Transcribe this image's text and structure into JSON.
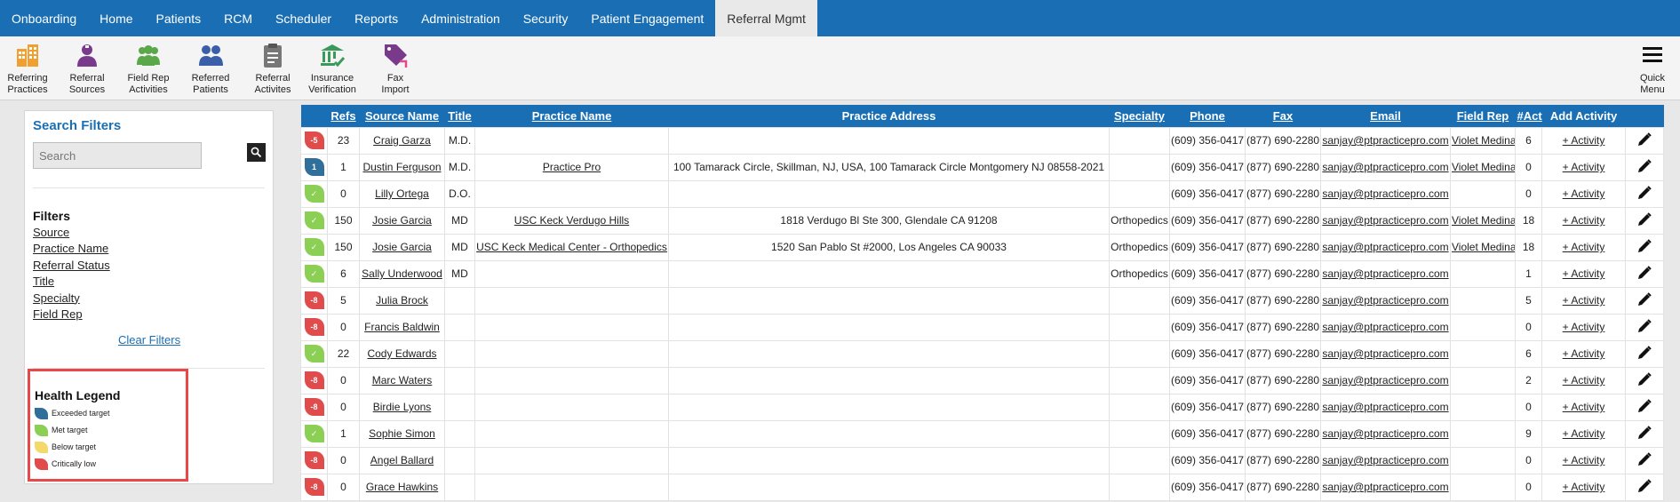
{
  "nav": {
    "items": [
      {
        "label": "Onboarding",
        "active": false
      },
      {
        "label": "Home",
        "active": false
      },
      {
        "label": "Patients",
        "active": false
      },
      {
        "label": "RCM",
        "active": false
      },
      {
        "label": "Scheduler",
        "active": false
      },
      {
        "label": "Reports",
        "active": false
      },
      {
        "label": "Administration",
        "active": false
      },
      {
        "label": "Security",
        "active": false
      },
      {
        "label": "Patient Engagement",
        "active": false
      },
      {
        "label": "Referral Mgmt",
        "active": true
      }
    ]
  },
  "toolbar": {
    "tools": [
      {
        "icon": "building-icon",
        "lines": [
          "Referring",
          "Practices"
        ],
        "color": "#f0a030"
      },
      {
        "icon": "doctor-icon",
        "lines": [
          "Referral",
          "Sources"
        ],
        "color": "#7a3a8c"
      },
      {
        "icon": "group-icon",
        "lines": [
          "Field Rep",
          "Activities"
        ],
        "color": "#5aa84a"
      },
      {
        "icon": "users-icon",
        "lines": [
          "Referred",
          "Patients"
        ],
        "color": "#3a5fa8"
      },
      {
        "icon": "clipboard-icon",
        "lines": [
          "Referral",
          "Activites"
        ],
        "color": "#777777"
      },
      {
        "icon": "bank-check-icon",
        "lines": [
          "Insurance",
          "Verification"
        ],
        "color": "#3a9a5a"
      },
      {
        "icon": "fax-tag-icon",
        "lines": [
          "Fax",
          "Import"
        ],
        "color": "#7a3a8c"
      }
    ],
    "quick_menu": [
      "Quick",
      "Menu"
    ]
  },
  "filters_panel": {
    "title": "Search Filters",
    "search_placeholder": "Search",
    "filters_heading": "Filters",
    "filters": [
      "Source",
      "Practice Name",
      "Referral Status",
      "Title",
      "Specialty",
      "Field Rep"
    ],
    "clear_label": "Clear Filters"
  },
  "legend": {
    "title": "Health Legend",
    "items": [
      {
        "label": "Exceeded target",
        "color": "#2f6f9a"
      },
      {
        "label": "Met target",
        "color": "#8ccf55"
      },
      {
        "label": "Below target",
        "color": "#f3d86a"
      },
      {
        "label": "Critically low",
        "color": "#e04b4b"
      }
    ]
  },
  "table": {
    "columns": [
      "",
      "Refs",
      "Source Name",
      "Title",
      "Practice Name",
      "Practice Address",
      "Specialty",
      "Phone",
      "Fax",
      "Email",
      "Field Rep",
      "#Act",
      "Add Activity",
      ""
    ],
    "add_activity_label": "+ Activity",
    "rows": [
      {
        "health": "red",
        "badge": "-5",
        "refs": "23",
        "source": "Craig Garza",
        "title": "M.D.",
        "practice": "",
        "address": "",
        "specialty": "",
        "phone": "(609) 356-0417",
        "fax": "(877) 690-2280",
        "email": "sanjay@ptpracticepro.com",
        "rep": "Violet Medina",
        "act": "6"
      },
      {
        "health": "blue",
        "badge": "1",
        "refs": "1",
        "source": "Dustin Ferguson",
        "title": "M.D.",
        "practice": "Practice Pro",
        "address": "100 Tamarack Circle, Skillman, NJ, USA, 100 Tamarack Circle Montgomery NJ 08558-2021",
        "specialty": "",
        "phone": "(609) 356-0417",
        "fax": "(877) 690-2280",
        "email": "sanjay@ptpracticepro.com",
        "rep": "Violet Medina",
        "act": "0"
      },
      {
        "health": "green",
        "badge": "✓",
        "refs": "0",
        "source": "Lilly Ortega",
        "title": "D.O.",
        "practice": "",
        "address": "",
        "specialty": "",
        "phone": "(609) 356-0417",
        "fax": "(877) 690-2280",
        "email": "sanjay@ptpracticepro.com",
        "rep": "",
        "act": "0"
      },
      {
        "health": "green",
        "badge": "✓",
        "refs": "150",
        "source": "Josie Garcia",
        "title": "MD",
        "practice": "USC Keck Verdugo Hills",
        "address": "1818 Verdugo Bl Ste 300, Glendale CA 91208",
        "specialty": "Orthopedics",
        "phone": "(609) 356-0417",
        "fax": "(877) 690-2280",
        "email": "sanjay@ptpracticepro.com",
        "rep": "Violet Medina",
        "act": "18"
      },
      {
        "health": "green",
        "badge": "✓",
        "refs": "150",
        "source": "Josie Garcia",
        "title": "MD",
        "practice": "USC Keck Medical Center - Orthopedics",
        "address": "1520 San Pablo St #2000, Los Angeles CA 90033",
        "specialty": "Orthopedics",
        "phone": "(609) 356-0417",
        "fax": "(877) 690-2280",
        "email": "sanjay@ptpracticepro.com",
        "rep": "Violet Medina",
        "act": "18"
      },
      {
        "health": "green",
        "badge": "✓",
        "refs": "6",
        "source": "Sally Underwood",
        "title": "MD",
        "practice": "",
        "address": "",
        "specialty": "Orthopedics",
        "phone": "(609) 356-0417",
        "fax": "(877) 690-2280",
        "email": "sanjay@ptpracticepro.com",
        "rep": "",
        "act": "1"
      },
      {
        "health": "red",
        "badge": "-8",
        "refs": "5",
        "source": "Julia Brock",
        "title": "",
        "practice": "",
        "address": "",
        "specialty": "",
        "phone": "(609) 356-0417",
        "fax": "(877) 690-2280",
        "email": "sanjay@ptpracticepro.com",
        "rep": "",
        "act": "5"
      },
      {
        "health": "red",
        "badge": "-8",
        "refs": "0",
        "source": "Francis Baldwin",
        "title": "",
        "practice": "",
        "address": "",
        "specialty": "",
        "phone": "(609) 356-0417",
        "fax": "(877) 690-2280",
        "email": "sanjay@ptpracticepro.com",
        "rep": "",
        "act": "0"
      },
      {
        "health": "green",
        "badge": "✓",
        "refs": "22",
        "source": "Cody Edwards",
        "title": "",
        "practice": "",
        "address": "",
        "specialty": "",
        "phone": "(609) 356-0417",
        "fax": "(877) 690-2280",
        "email": "sanjay@ptpracticepro.com",
        "rep": "",
        "act": "6"
      },
      {
        "health": "red",
        "badge": "-8",
        "refs": "0",
        "source": "Marc Waters",
        "title": "",
        "practice": "",
        "address": "",
        "specialty": "",
        "phone": "(609) 356-0417",
        "fax": "(877) 690-2280",
        "email": "sanjay@ptpracticepro.com",
        "rep": "",
        "act": "2"
      },
      {
        "health": "red",
        "badge": "-8",
        "refs": "0",
        "source": "Birdie Lyons",
        "title": "",
        "practice": "",
        "address": "",
        "specialty": "",
        "phone": "(609) 356-0417",
        "fax": "(877) 690-2280",
        "email": "sanjay@ptpracticepro.com",
        "rep": "",
        "act": "0"
      },
      {
        "health": "green",
        "badge": "✓",
        "refs": "1",
        "source": "Sophie Simon",
        "title": "",
        "practice": "",
        "address": "",
        "specialty": "",
        "phone": "(609) 356-0417",
        "fax": "(877) 690-2280",
        "email": "sanjay@ptpracticepro.com",
        "rep": "",
        "act": "9"
      },
      {
        "health": "red",
        "badge": "-8",
        "refs": "0",
        "source": "Angel Ballard",
        "title": "",
        "practice": "",
        "address": "",
        "specialty": "",
        "phone": "(609) 356-0417",
        "fax": "(877) 690-2280",
        "email": "sanjay@ptpracticepro.com",
        "rep": "",
        "act": "0"
      },
      {
        "health": "red",
        "badge": "-8",
        "refs": "0",
        "source": "Grace Hawkins",
        "title": "",
        "practice": "",
        "address": "",
        "specialty": "",
        "phone": "(609) 356-0417",
        "fax": "(877) 690-2280",
        "email": "sanjay@ptpracticepro.com",
        "rep": "",
        "act": "0"
      }
    ]
  }
}
